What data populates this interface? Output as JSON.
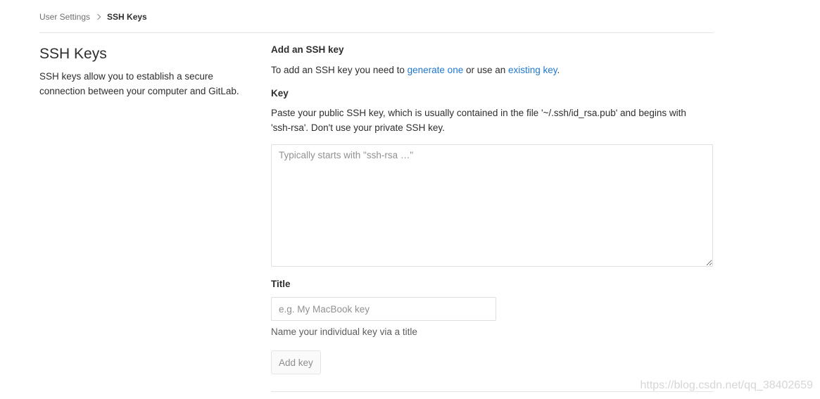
{
  "breadcrumb": {
    "parent": "User Settings",
    "current": "SSH Keys",
    "separator_icon": "chevron-right-icon"
  },
  "sidebar_info": {
    "title": "SSH Keys",
    "description": "SSH keys allow you to establish a secure connection between your computer and GitLab."
  },
  "form": {
    "section_title": "Add an SSH key",
    "intro_prefix": "To add an SSH key you need to ",
    "generate_link": "generate one",
    "intro_middle": " or use an ",
    "existing_link": "existing key",
    "intro_suffix": ".",
    "key_label": "Key",
    "key_help": "Paste your public SSH key, which is usually contained in the file '~/.ssh/id_rsa.pub' and begins with 'ssh-rsa'. Don't use your private SSH key.",
    "key_value": "",
    "key_placeholder": "Typically starts with \"ssh-rsa …\"",
    "title_label": "Title",
    "title_value": "",
    "title_placeholder": "e.g. My MacBook key",
    "title_help": "Name your individual key via a title",
    "submit_label": "Add key"
  },
  "watermark": "https://blog.csdn.net/qq_38402659",
  "colors": {
    "link": "#1f78d1",
    "text": "#2e2e2e",
    "border": "#dfdfdf"
  }
}
